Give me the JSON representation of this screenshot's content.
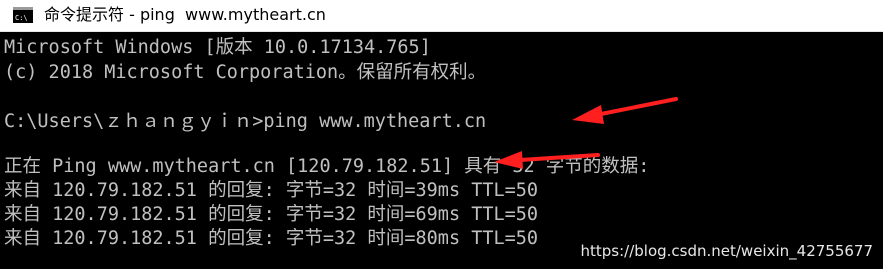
{
  "window": {
    "title": "命令提示符 - ping  www.mytheart.cn",
    "icon": "cmd-icon"
  },
  "console": {
    "lines": [
      "Microsoft Windows [版本 10.0.17134.765]",
      "(c) 2018 Microsoft Corporation。保留所有权利。",
      "",
      "C:\\Users\\ｚｈａｎｇｙｉｎ>ping www.mytheart.cn",
      "",
      "正在 Ping www.mytheart.cn [120.79.182.51] 具有 32 字节的数据:",
      "来自 120.79.182.51 的回复: 字节=32 时间=39ms TTL=50",
      "来自 120.79.182.51 的回复: 字节=32 时间=69ms TTL=50",
      "来自 120.79.182.51 的回复: 字节=32 时间=80ms TTL=50"
    ]
  },
  "watermark": "https://blog.csdn.net/weixin_42755677",
  "colors": {
    "console_bg": "#000000",
    "console_text": "#c0c0c0",
    "annotation_arrow": "#ff1f1f",
    "titlebar_bg": "#ffffff"
  }
}
